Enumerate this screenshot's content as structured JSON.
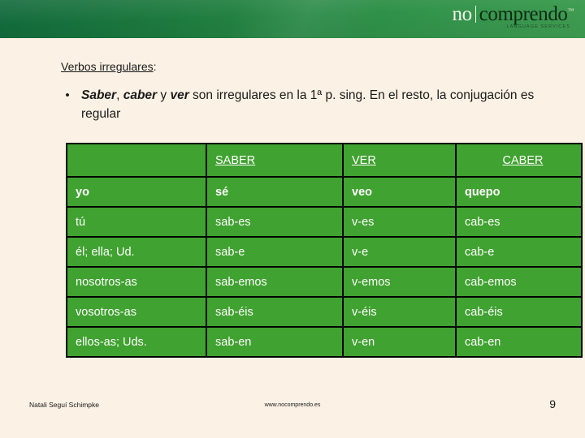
{
  "colors": {
    "banner_dark": "#11693a",
    "banner_light": "#3f9d52",
    "page_background": "#fbf1e4",
    "table_cell": "#40a230",
    "table_border": "#000000",
    "text_dark": "#101010",
    "text_white": "#ffffff"
  },
  "logo": {
    "word_one": "no",
    "word_two": "comprendo",
    "trademark": "™",
    "tagline": "LANGUAGE SERVICES"
  },
  "content": {
    "heading": "Verbos irregulares",
    "heading_suffix": ":",
    "bullet_marker": "•",
    "bullet": {
      "verb_1": "Saber",
      "sep_1": ", ",
      "verb_2": "caber",
      "sep_2": " y ",
      "verb_3": "ver",
      "rest": " son irregulares en la 1ª p. sing. En el resto, la conjugación es regular"
    }
  },
  "table": {
    "columns": [
      "",
      "SABER",
      "VER",
      "CABER"
    ],
    "rows": [
      {
        "pronoun": "yo",
        "saber": "sé",
        "ver": "veo",
        "caber": "quepo"
      },
      {
        "pronoun": "tú",
        "saber": "sab-es",
        "ver": "v-es",
        "caber": "cab-es"
      },
      {
        "pronoun": "él; ella; Ud.",
        "saber": "sab-e",
        "ver": "v-e",
        "caber": "cab-e"
      },
      {
        "pronoun": "nosotros-as",
        "saber": "sab-emos",
        "ver": "v-emos",
        "caber": "cab-emos"
      },
      {
        "pronoun": "vosotros-as",
        "saber": "sab-éis",
        "ver": "v-éis",
        "caber": "cab-éis"
      },
      {
        "pronoun": "ellos-as; Uds.",
        "saber": "sab-en",
        "ver": "v-en",
        "caber": "cab-en"
      }
    ]
  },
  "footer": {
    "author": "Natali Seguí Schimpke",
    "url": "www.nocomprendo.es",
    "page_number": "9"
  }
}
